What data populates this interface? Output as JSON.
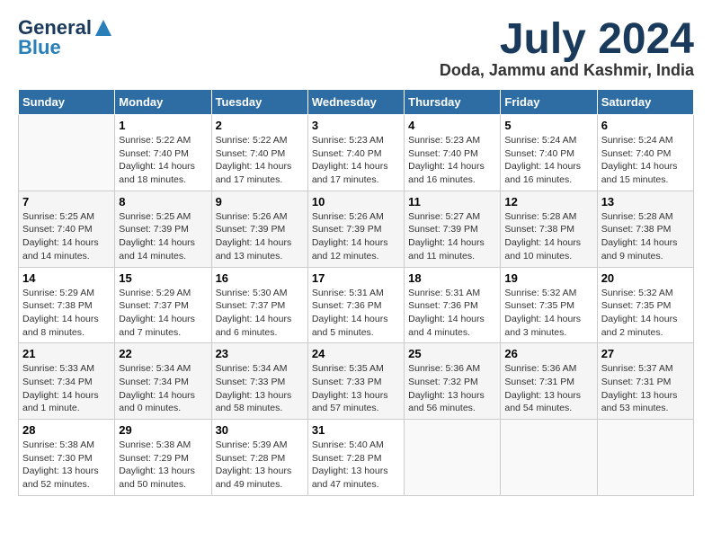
{
  "header": {
    "logo_line1": "General",
    "logo_line2": "Blue",
    "month": "July 2024",
    "location": "Doda, Jammu and Kashmir, India"
  },
  "weekdays": [
    "Sunday",
    "Monday",
    "Tuesday",
    "Wednesday",
    "Thursday",
    "Friday",
    "Saturday"
  ],
  "weeks": [
    [
      {
        "day": "",
        "sunrise": "",
        "sunset": "",
        "daylight": ""
      },
      {
        "day": "1",
        "sunrise": "Sunrise: 5:22 AM",
        "sunset": "Sunset: 7:40 PM",
        "daylight": "Daylight: 14 hours and 18 minutes."
      },
      {
        "day": "2",
        "sunrise": "Sunrise: 5:22 AM",
        "sunset": "Sunset: 7:40 PM",
        "daylight": "Daylight: 14 hours and 17 minutes."
      },
      {
        "day": "3",
        "sunrise": "Sunrise: 5:23 AM",
        "sunset": "Sunset: 7:40 PM",
        "daylight": "Daylight: 14 hours and 17 minutes."
      },
      {
        "day": "4",
        "sunrise": "Sunrise: 5:23 AM",
        "sunset": "Sunset: 7:40 PM",
        "daylight": "Daylight: 14 hours and 16 minutes."
      },
      {
        "day": "5",
        "sunrise": "Sunrise: 5:24 AM",
        "sunset": "Sunset: 7:40 PM",
        "daylight": "Daylight: 14 hours and 16 minutes."
      },
      {
        "day": "6",
        "sunrise": "Sunrise: 5:24 AM",
        "sunset": "Sunset: 7:40 PM",
        "daylight": "Daylight: 14 hours and 15 minutes."
      }
    ],
    [
      {
        "day": "7",
        "sunrise": "Sunrise: 5:25 AM",
        "sunset": "Sunset: 7:40 PM",
        "daylight": "Daylight: 14 hours and 14 minutes."
      },
      {
        "day": "8",
        "sunrise": "Sunrise: 5:25 AM",
        "sunset": "Sunset: 7:39 PM",
        "daylight": "Daylight: 14 hours and 14 minutes."
      },
      {
        "day": "9",
        "sunrise": "Sunrise: 5:26 AM",
        "sunset": "Sunset: 7:39 PM",
        "daylight": "Daylight: 14 hours and 13 minutes."
      },
      {
        "day": "10",
        "sunrise": "Sunrise: 5:26 AM",
        "sunset": "Sunset: 7:39 PM",
        "daylight": "Daylight: 14 hours and 12 minutes."
      },
      {
        "day": "11",
        "sunrise": "Sunrise: 5:27 AM",
        "sunset": "Sunset: 7:39 PM",
        "daylight": "Daylight: 14 hours and 11 minutes."
      },
      {
        "day": "12",
        "sunrise": "Sunrise: 5:28 AM",
        "sunset": "Sunset: 7:38 PM",
        "daylight": "Daylight: 14 hours and 10 minutes."
      },
      {
        "day": "13",
        "sunrise": "Sunrise: 5:28 AM",
        "sunset": "Sunset: 7:38 PM",
        "daylight": "Daylight: 14 hours and 9 minutes."
      }
    ],
    [
      {
        "day": "14",
        "sunrise": "Sunrise: 5:29 AM",
        "sunset": "Sunset: 7:38 PM",
        "daylight": "Daylight: 14 hours and 8 minutes."
      },
      {
        "day": "15",
        "sunrise": "Sunrise: 5:29 AM",
        "sunset": "Sunset: 7:37 PM",
        "daylight": "Daylight: 14 hours and 7 minutes."
      },
      {
        "day": "16",
        "sunrise": "Sunrise: 5:30 AM",
        "sunset": "Sunset: 7:37 PM",
        "daylight": "Daylight: 14 hours and 6 minutes."
      },
      {
        "day": "17",
        "sunrise": "Sunrise: 5:31 AM",
        "sunset": "Sunset: 7:36 PM",
        "daylight": "Daylight: 14 hours and 5 minutes."
      },
      {
        "day": "18",
        "sunrise": "Sunrise: 5:31 AM",
        "sunset": "Sunset: 7:36 PM",
        "daylight": "Daylight: 14 hours and 4 minutes."
      },
      {
        "day": "19",
        "sunrise": "Sunrise: 5:32 AM",
        "sunset": "Sunset: 7:35 PM",
        "daylight": "Daylight: 14 hours and 3 minutes."
      },
      {
        "day": "20",
        "sunrise": "Sunrise: 5:32 AM",
        "sunset": "Sunset: 7:35 PM",
        "daylight": "Daylight: 14 hours and 2 minutes."
      }
    ],
    [
      {
        "day": "21",
        "sunrise": "Sunrise: 5:33 AM",
        "sunset": "Sunset: 7:34 PM",
        "daylight": "Daylight: 14 hours and 1 minute."
      },
      {
        "day": "22",
        "sunrise": "Sunrise: 5:34 AM",
        "sunset": "Sunset: 7:34 PM",
        "daylight": "Daylight: 14 hours and 0 minutes."
      },
      {
        "day": "23",
        "sunrise": "Sunrise: 5:34 AM",
        "sunset": "Sunset: 7:33 PM",
        "daylight": "Daylight: 13 hours and 58 minutes."
      },
      {
        "day": "24",
        "sunrise": "Sunrise: 5:35 AM",
        "sunset": "Sunset: 7:33 PM",
        "daylight": "Daylight: 13 hours and 57 minutes."
      },
      {
        "day": "25",
        "sunrise": "Sunrise: 5:36 AM",
        "sunset": "Sunset: 7:32 PM",
        "daylight": "Daylight: 13 hours and 56 minutes."
      },
      {
        "day": "26",
        "sunrise": "Sunrise: 5:36 AM",
        "sunset": "Sunset: 7:31 PM",
        "daylight": "Daylight: 13 hours and 54 minutes."
      },
      {
        "day": "27",
        "sunrise": "Sunrise: 5:37 AM",
        "sunset": "Sunset: 7:31 PM",
        "daylight": "Daylight: 13 hours and 53 minutes."
      }
    ],
    [
      {
        "day": "28",
        "sunrise": "Sunrise: 5:38 AM",
        "sunset": "Sunset: 7:30 PM",
        "daylight": "Daylight: 13 hours and 52 minutes."
      },
      {
        "day": "29",
        "sunrise": "Sunrise: 5:38 AM",
        "sunset": "Sunset: 7:29 PM",
        "daylight": "Daylight: 13 hours and 50 minutes."
      },
      {
        "day": "30",
        "sunrise": "Sunrise: 5:39 AM",
        "sunset": "Sunset: 7:28 PM",
        "daylight": "Daylight: 13 hours and 49 minutes."
      },
      {
        "day": "31",
        "sunrise": "Sunrise: 5:40 AM",
        "sunset": "Sunset: 7:28 PM",
        "daylight": "Daylight: 13 hours and 47 minutes."
      },
      {
        "day": "",
        "sunrise": "",
        "sunset": "",
        "daylight": ""
      },
      {
        "day": "",
        "sunrise": "",
        "sunset": "",
        "daylight": ""
      },
      {
        "day": "",
        "sunrise": "",
        "sunset": "",
        "daylight": ""
      }
    ]
  ]
}
